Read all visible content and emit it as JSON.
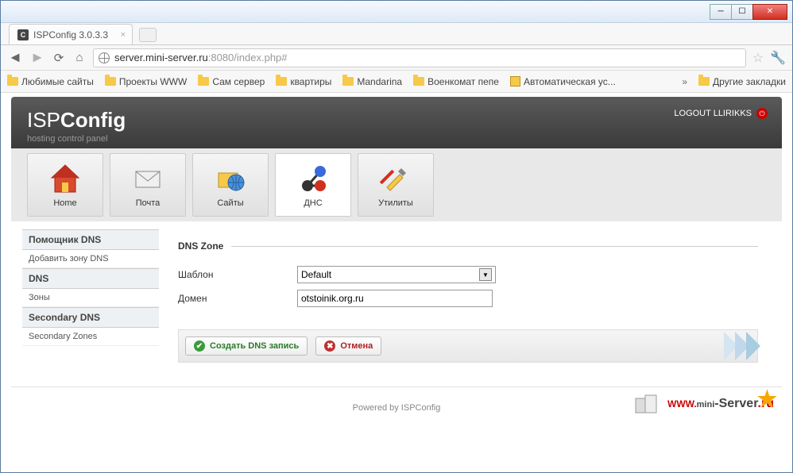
{
  "window": {
    "tab_title": "ISPConfig 3.0.3.3",
    "tab_favicon_letter": "C"
  },
  "toolbar": {
    "url_host": "server.mini-server.ru",
    "url_port_path": ":8080/index.php#"
  },
  "bookmarks": {
    "items": [
      "Любимые сайты",
      "Проекты WWW",
      "Сам сервер",
      "квартиры",
      "Mandarina",
      "Военкомат пепе",
      "Автоматическая ус..."
    ],
    "other": "Другие закладки"
  },
  "header": {
    "logo_thin": "ISP",
    "logo_bold": "Config",
    "subtitle": "hosting control panel",
    "logout_label": "LOGOUT LLIRIKKS"
  },
  "topnav": {
    "items": [
      "Home",
      "Почта",
      "Сайты",
      "ДНС",
      "Утилиты"
    ],
    "active_index": 3
  },
  "sidebar": {
    "groups": [
      {
        "title": "Помощник DNS",
        "links": [
          "Добавить зону DNS"
        ]
      },
      {
        "title": "DNS",
        "links": [
          "Зоны"
        ]
      },
      {
        "title": "Secondary DNS",
        "links": [
          "Secondary Zones"
        ]
      }
    ]
  },
  "form": {
    "legend": "DNS Zone",
    "template_label": "Шаблон",
    "template_value": "Default",
    "domain_label": "Домен",
    "domain_value": "otstoinik.org.ru"
  },
  "actions": {
    "create": "Создать DNS запись",
    "cancel": "Отмена"
  },
  "footer": {
    "text": "Powered by ISPConfig"
  },
  "watermark": {
    "www": "WWW.",
    "mini": "mini",
    "server": "-Server",
    "ru": ".ru"
  }
}
